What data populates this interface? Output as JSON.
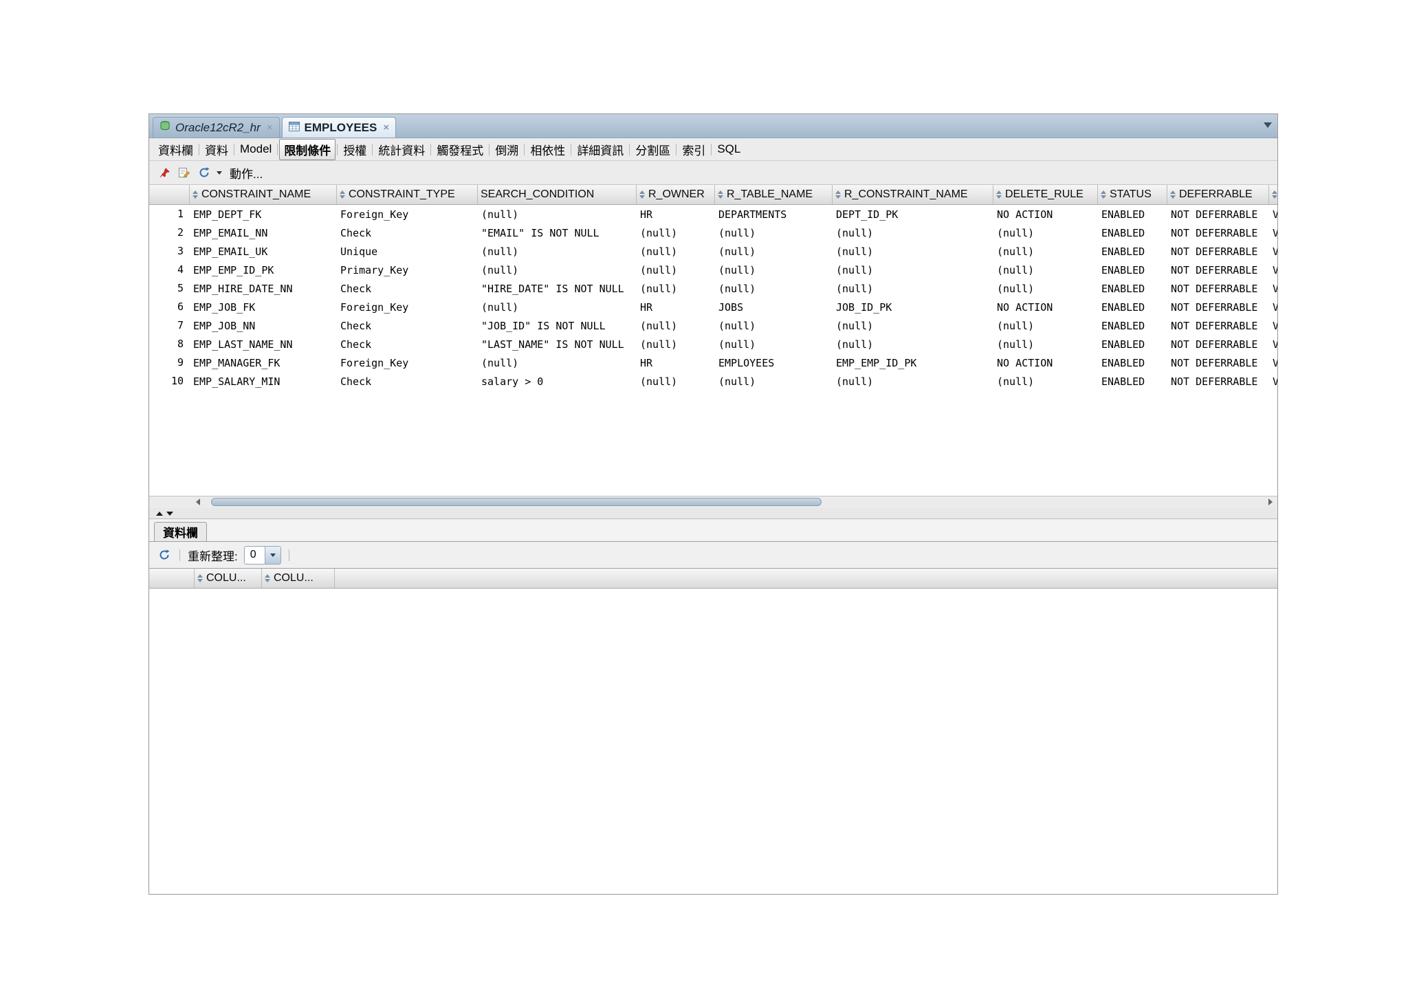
{
  "doc_tabs": [
    {
      "label": "Oracle12cR2_hr",
      "icon": "sql-connection-icon",
      "active": false
    },
    {
      "label": "EMPLOYEES",
      "icon": "table-icon",
      "active": true
    }
  ],
  "subtabs": {
    "items": [
      "資料欄",
      "資料",
      "Model",
      "限制條件",
      "授權",
      "統計資料",
      "觸發程式",
      "倒溯",
      "相依性",
      "詳細資訊",
      "分割區",
      "索引",
      "SQL"
    ],
    "active": "限制條件"
  },
  "toolbar": {
    "actions_label": "動作..."
  },
  "constraints_table": {
    "columns": [
      "CONSTRAINT_NAME",
      "CONSTRAINT_TYPE",
      "SEARCH_CONDITION",
      "R_OWNER",
      "R_TABLE_NAME",
      "R_CONSTRAINT_NAME",
      "DELETE_RULE",
      "STATUS",
      "DEFERRABLE"
    ],
    "rows": [
      {
        "n": "1",
        "cells": [
          "EMP_DEPT_FK",
          "Foreign_Key",
          "(null)",
          "HR",
          "DEPARTMENTS",
          "DEPT_ID_PK",
          "NO ACTION",
          "ENABLED",
          "NOT DEFERRABLE",
          "VA"
        ]
      },
      {
        "n": "2",
        "cells": [
          "EMP_EMAIL_NN",
          "Check",
          "\"EMAIL\" IS NOT NULL",
          "(null)",
          "(null)",
          "(null)",
          "(null)",
          "ENABLED",
          "NOT DEFERRABLE",
          "VA"
        ]
      },
      {
        "n": "3",
        "cells": [
          "EMP_EMAIL_UK",
          "Unique",
          "(null)",
          "(null)",
          "(null)",
          "(null)",
          "(null)",
          "ENABLED",
          "NOT DEFERRABLE",
          "VA"
        ]
      },
      {
        "n": "4",
        "cells": [
          "EMP_EMP_ID_PK",
          "Primary_Key",
          "(null)",
          "(null)",
          "(null)",
          "(null)",
          "(null)",
          "ENABLED",
          "NOT DEFERRABLE",
          "VA"
        ]
      },
      {
        "n": "5",
        "cells": [
          "EMP_HIRE_DATE_NN",
          "Check",
          "\"HIRE_DATE\" IS NOT NULL",
          "(null)",
          "(null)",
          "(null)",
          "(null)",
          "ENABLED",
          "NOT DEFERRABLE",
          "VA"
        ]
      },
      {
        "n": "6",
        "cells": [
          "EMP_JOB_FK",
          "Foreign_Key",
          "(null)",
          "HR",
          "JOBS",
          "JOB_ID_PK",
          "NO ACTION",
          "ENABLED",
          "NOT DEFERRABLE",
          "VA"
        ]
      },
      {
        "n": "7",
        "cells": [
          "EMP_JOB_NN",
          "Check",
          "\"JOB_ID\" IS NOT NULL",
          "(null)",
          "(null)",
          "(null)",
          "(null)",
          "ENABLED",
          "NOT DEFERRABLE",
          "VA"
        ]
      },
      {
        "n": "8",
        "cells": [
          "EMP_LAST_NAME_NN",
          "Check",
          "\"LAST_NAME\" IS NOT NULL",
          "(null)",
          "(null)",
          "(null)",
          "(null)",
          "ENABLED",
          "NOT DEFERRABLE",
          "VA"
        ]
      },
      {
        "n": "9",
        "cells": [
          "EMP_MANAGER_FK",
          "Foreign_Key",
          "(null)",
          "HR",
          "EMPLOYEES",
          "EMP_EMP_ID_PK",
          "NO ACTION",
          "ENABLED",
          "NOT DEFERRABLE",
          "VA"
        ]
      },
      {
        "n": "10",
        "cells": [
          "EMP_SALARY_MIN",
          "Check",
          "salary > 0",
          "(null)",
          "(null)",
          "(null)",
          "(null)",
          "ENABLED",
          "NOT DEFERRABLE",
          "VA"
        ]
      }
    ]
  },
  "bottom_panel": {
    "tab_label": "資料欄",
    "refresh_label": "重新整理:",
    "refresh_count": "0",
    "columns": [
      "COLU...",
      "COLU..."
    ]
  }
}
